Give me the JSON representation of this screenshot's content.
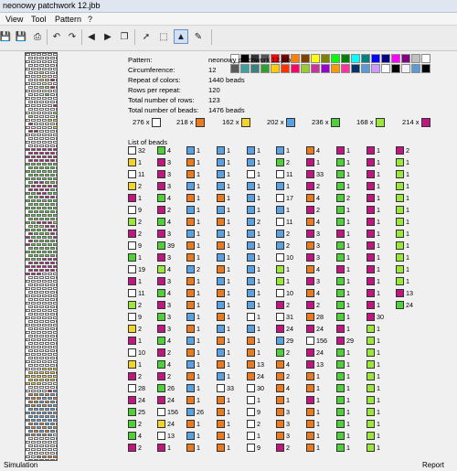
{
  "window": {
    "title": "neonowy patchwork 12.jbb"
  },
  "menu": {
    "items": [
      "View",
      "Tool",
      "Pattern",
      "?"
    ]
  },
  "toolbar": {
    "icons": [
      "save-icon",
      "print-icon",
      "undo-icon",
      "redo-icon",
      "arrow-left-icon",
      "arrow-right-icon",
      "copy-icon",
      "pointer-icon",
      "select-rectangle-icon",
      "fill-bucket-icon",
      "color-picker-icon"
    ]
  },
  "palette": {
    "row1": [
      "#ffffff",
      "#000000",
      "#333333",
      "#555555",
      "#ff0000",
      "#800000",
      "#ff8000",
      "#804000",
      "#ffff00",
      "#808000",
      "#00ff00",
      "#008000",
      "#00ffff",
      "#008080",
      "#0000ff",
      "#000080",
      "#ff00ff",
      "#800080",
      "#c0c0c0",
      "#ffffff"
    ],
    "row2": [
      "#5a5a5a",
      "#40a0a0",
      "#3c7f7f",
      "#30a030",
      "#ffcc00",
      "#ff3300",
      "#ff0066",
      "#99cc33",
      "#cc3399",
      "#9900cc",
      "#ff9900",
      "#ff3399",
      "#003366",
      "#5b9bd5",
      "#cc99ff",
      "#ffffff",
      "#000000",
      "#f5f5f5",
      "#5b9bd5",
      "#000000"
    ]
  },
  "colors": {
    "white": "#ffffff",
    "orange": "#ea7a20",
    "yellow": "#f3d42c",
    "blue": "#5aa1e2",
    "green": "#4fcf3a",
    "lime": "#9be63c",
    "magenta": "#c0167f"
  },
  "properties": [
    {
      "key": "Pattern:",
      "value": "neonowy patchwork 12.jbb"
    },
    {
      "key": "Circumference:",
      "value": "12"
    },
    {
      "key": "Repeat of colors:",
      "value": "1440 beads"
    },
    {
      "key": "Rows per repeat:",
      "value": "120"
    },
    {
      "key": "Total number of rows:",
      "value": "123"
    },
    {
      "key": "Total number of beads:",
      "value": "1476 beads"
    }
  ],
  "color_counts": [
    {
      "label": "276 x",
      "color": "white"
    },
    {
      "label": "218 x",
      "color": "orange"
    },
    {
      "label": "162 x",
      "color": "yellow"
    },
    {
      "label": "202 x",
      "color": "blue"
    },
    {
      "label": "236 x",
      "color": "green"
    },
    {
      "label": "168 x",
      "color": "lime"
    },
    {
      "label": "214 x",
      "color": "magenta"
    }
  ],
  "bead_list_title": "List of beads",
  "bead_columns": [
    [
      [
        "white",
        "32"
      ],
      [
        "yellow",
        "1"
      ],
      [
        "white",
        "11"
      ],
      [
        "yellow",
        "2"
      ],
      [
        "magenta",
        "1"
      ],
      [
        "white",
        "9"
      ],
      [
        "lime",
        "2"
      ],
      [
        "magenta",
        "2"
      ],
      [
        "white",
        "9"
      ],
      [
        "green",
        "1"
      ],
      [
        "white",
        "19"
      ],
      [
        "magenta",
        "1"
      ],
      [
        "white",
        "11"
      ],
      [
        "lime",
        "2"
      ],
      [
        "white",
        "9"
      ],
      [
        "yellow",
        "2"
      ],
      [
        "magenta",
        "1"
      ],
      [
        "white",
        "10"
      ],
      [
        "yellow",
        "1"
      ],
      [
        "magenta",
        "2"
      ],
      [
        "white",
        "28"
      ],
      [
        "magenta",
        "24"
      ],
      [
        "green",
        "25"
      ],
      [
        "green",
        "2"
      ],
      [
        "green",
        "4"
      ],
      [
        "magenta",
        "2"
      ]
    ],
    [
      [
        "green",
        "4"
      ],
      [
        "magenta",
        "3"
      ],
      [
        "magenta",
        "3"
      ],
      [
        "magenta",
        "3"
      ],
      [
        "green",
        "4"
      ],
      [
        "magenta",
        "2"
      ],
      [
        "green",
        "4"
      ],
      [
        "magenta",
        "3"
      ],
      [
        "green",
        "39"
      ],
      [
        "magenta",
        "3"
      ],
      [
        "lime",
        "4"
      ],
      [
        "magenta",
        "3"
      ],
      [
        "green",
        "4"
      ],
      [
        "magenta",
        "3"
      ],
      [
        "green",
        "3"
      ],
      [
        "magenta",
        "3"
      ],
      [
        "green",
        "4"
      ],
      [
        "magenta",
        "2"
      ],
      [
        "green",
        "4"
      ],
      [
        "magenta",
        "2"
      ],
      [
        "green",
        "26"
      ],
      [
        "magenta",
        "24"
      ],
      [
        "white",
        "156"
      ],
      [
        "yellow",
        "24"
      ],
      [
        "white",
        "13"
      ],
      [
        "magenta",
        "1"
      ]
    ],
    [
      [
        "blue",
        "1"
      ],
      [
        "orange",
        "1"
      ],
      [
        "orange",
        "1"
      ],
      [
        "blue",
        "1"
      ],
      [
        "orange",
        "1"
      ],
      [
        "blue",
        "1"
      ],
      [
        "orange",
        "1"
      ],
      [
        "blue",
        "1"
      ],
      [
        "orange",
        "1"
      ],
      [
        "orange",
        "1"
      ],
      [
        "blue",
        "2"
      ],
      [
        "orange",
        "1"
      ],
      [
        "orange",
        "1"
      ],
      [
        "orange",
        "1"
      ],
      [
        "blue",
        "1"
      ],
      [
        "orange",
        "1"
      ],
      [
        "blue",
        "1"
      ],
      [
        "orange",
        "1"
      ],
      [
        "blue",
        "1"
      ],
      [
        "orange",
        "1"
      ],
      [
        "blue",
        "1"
      ],
      [
        "orange",
        "1"
      ],
      [
        "blue",
        "26"
      ],
      [
        "orange",
        "1"
      ],
      [
        "blue",
        "1"
      ],
      [
        "orange",
        "1"
      ]
    ],
    [
      [
        "blue",
        "1"
      ],
      [
        "blue",
        "1"
      ],
      [
        "blue",
        "1"
      ],
      [
        "blue",
        "1"
      ],
      [
        "orange",
        "1"
      ],
      [
        "blue",
        "1"
      ],
      [
        "orange",
        "1"
      ],
      [
        "blue",
        "1"
      ],
      [
        "orange",
        "1"
      ],
      [
        "blue",
        "1"
      ],
      [
        "orange",
        "1"
      ],
      [
        "blue",
        "1"
      ],
      [
        "orange",
        "1"
      ],
      [
        "blue",
        "1"
      ],
      [
        "orange",
        "1"
      ],
      [
        "blue",
        "1"
      ],
      [
        "orange",
        "1"
      ],
      [
        "blue",
        "1"
      ],
      [
        "orange",
        "1"
      ],
      [
        "blue",
        "1"
      ],
      [
        "white",
        "33"
      ],
      [
        "orange",
        "1"
      ],
      [
        "orange",
        "1"
      ],
      [
        "orange",
        "1"
      ],
      [
        "orange",
        "1"
      ],
      [
        "orange",
        "1"
      ]
    ],
    [
      [
        "blue",
        "1"
      ],
      [
        "blue",
        "1"
      ],
      [
        "white",
        "1"
      ],
      [
        "blue",
        "1"
      ],
      [
        "blue",
        "1"
      ],
      [
        "blue",
        "1"
      ],
      [
        "blue",
        "2"
      ],
      [
        "blue",
        "1"
      ],
      [
        "blue",
        "1"
      ],
      [
        "blue",
        "1"
      ],
      [
        "blue",
        "1"
      ],
      [
        "blue",
        "1"
      ],
      [
        "blue",
        "1"
      ],
      [
        "blue",
        "1"
      ],
      [
        "white",
        "1"
      ],
      [
        "blue",
        "1"
      ],
      [
        "orange",
        "1"
      ],
      [
        "orange",
        "1"
      ],
      [
        "orange",
        "13"
      ],
      [
        "orange",
        "24"
      ],
      [
        "white",
        "30"
      ],
      [
        "white",
        "1"
      ],
      [
        "white",
        "9"
      ],
      [
        "white",
        "2"
      ],
      [
        "white",
        "1"
      ],
      [
        "white",
        "9"
      ]
    ],
    [
      [
        "blue",
        "1"
      ],
      [
        "green",
        "2"
      ],
      [
        "white",
        "11"
      ],
      [
        "blue",
        "1"
      ],
      [
        "white",
        "17"
      ],
      [
        "blue",
        "1"
      ],
      [
        "white",
        "11"
      ],
      [
        "blue",
        "2"
      ],
      [
        "blue",
        "2"
      ],
      [
        "white",
        "10"
      ],
      [
        "lime",
        "1"
      ],
      [
        "lime",
        "1"
      ],
      [
        "white",
        "10"
      ],
      [
        "magenta",
        "2"
      ],
      [
        "white",
        "31"
      ],
      [
        "magenta",
        "24"
      ],
      [
        "blue",
        "29"
      ],
      [
        "green",
        "2"
      ],
      [
        "orange",
        "4"
      ],
      [
        "orange",
        "2"
      ],
      [
        "orange",
        "4"
      ],
      [
        "orange",
        "1"
      ],
      [
        "orange",
        "3"
      ],
      [
        "orange",
        "3"
      ],
      [
        "orange",
        "3"
      ],
      [
        "magenta",
        "2"
      ]
    ],
    [
      [
        "orange",
        "4"
      ],
      [
        "magenta",
        "1"
      ],
      [
        "magenta",
        "33"
      ],
      [
        "magenta",
        "2"
      ],
      [
        "orange",
        "4"
      ],
      [
        "magenta",
        "2"
      ],
      [
        "orange",
        "4"
      ],
      [
        "magenta",
        "3"
      ],
      [
        "orange",
        "3"
      ],
      [
        "magenta",
        "3"
      ],
      [
        "orange",
        "4"
      ],
      [
        "magenta",
        "3"
      ],
      [
        "orange",
        "4"
      ],
      [
        "magenta",
        "2"
      ],
      [
        "orange",
        "28"
      ],
      [
        "magenta",
        "24"
      ],
      [
        "white",
        "156"
      ],
      [
        "magenta",
        "24"
      ],
      [
        "magenta",
        "13"
      ],
      [
        "orange",
        "1"
      ],
      [
        "orange",
        "1"
      ],
      [
        "magenta",
        "1"
      ],
      [
        "orange",
        "1"
      ],
      [
        "orange",
        "1"
      ],
      [
        "orange",
        "1"
      ],
      [
        "orange",
        "1"
      ]
    ],
    [
      [
        "magenta",
        "1"
      ],
      [
        "green",
        "1"
      ],
      [
        "green",
        "1"
      ],
      [
        "green",
        "1"
      ],
      [
        "green",
        "2"
      ],
      [
        "green",
        "1"
      ],
      [
        "green",
        "1"
      ],
      [
        "magenta",
        "1"
      ],
      [
        "green",
        "1"
      ],
      [
        "green",
        "1"
      ],
      [
        "magenta",
        "1"
      ],
      [
        "green",
        "1"
      ],
      [
        "green",
        "1"
      ],
      [
        "green",
        "1"
      ],
      [
        "green",
        "1"
      ],
      [
        "magenta",
        "1"
      ],
      [
        "magenta",
        "29"
      ],
      [
        "green",
        "1"
      ],
      [
        "green",
        "1"
      ],
      [
        "green",
        "1"
      ],
      [
        "green",
        "1"
      ],
      [
        "green",
        "1"
      ],
      [
        "green",
        "1"
      ],
      [
        "green",
        "1"
      ],
      [
        "green",
        "1"
      ],
      [
        "green",
        "1"
      ]
    ],
    [
      [
        "magenta",
        "1"
      ],
      [
        "magenta",
        "1"
      ],
      [
        "magenta",
        "1"
      ],
      [
        "magenta",
        "1"
      ],
      [
        "magenta",
        "1"
      ],
      [
        "magenta",
        "1"
      ],
      [
        "magenta",
        "1"
      ],
      [
        "magenta",
        "1"
      ],
      [
        "magenta",
        "1"
      ],
      [
        "magenta",
        "1"
      ],
      [
        "magenta",
        "1"
      ],
      [
        "magenta",
        "1"
      ],
      [
        "magenta",
        "1"
      ],
      [
        "magenta",
        "1"
      ],
      [
        "magenta",
        "30"
      ],
      [
        "lime",
        "1"
      ],
      [
        "lime",
        "1"
      ],
      [
        "lime",
        "1"
      ],
      [
        "lime",
        "1"
      ],
      [
        "lime",
        "1"
      ],
      [
        "lime",
        "1"
      ],
      [
        "lime",
        "1"
      ],
      [
        "lime",
        "1"
      ],
      [
        "lime",
        "1"
      ],
      [
        "lime",
        "1"
      ],
      [
        "lime",
        "1"
      ]
    ],
    [
      [
        "magenta",
        "2"
      ],
      [
        "lime",
        "1"
      ],
      [
        "lime",
        "1"
      ],
      [
        "lime",
        "1"
      ],
      [
        "lime",
        "1"
      ],
      [
        "lime",
        "1"
      ],
      [
        "lime",
        "1"
      ],
      [
        "lime",
        "1"
      ],
      [
        "lime",
        "1"
      ],
      [
        "lime",
        "1"
      ],
      [
        "lime",
        "1"
      ],
      [
        "lime",
        "1"
      ],
      [
        "magenta",
        "13"
      ],
      [
        "green",
        "24"
      ]
    ]
  ],
  "simulation_label": "Simulation",
  "report_label": "Report"
}
